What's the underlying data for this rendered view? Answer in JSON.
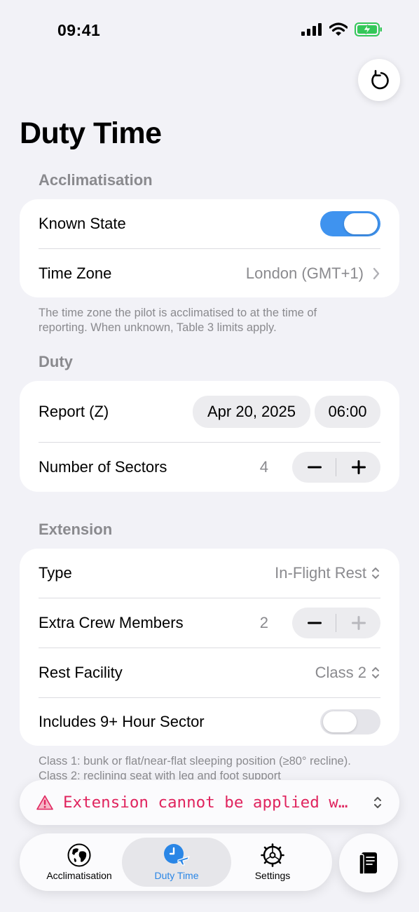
{
  "status": {
    "time": "09:41"
  },
  "page": {
    "title": "Duty Time"
  },
  "acclimatisation": {
    "header": "Acclimatisation",
    "known_state_label": "Known State",
    "known_state_on": true,
    "time_zone_label": "Time Zone",
    "time_zone_value": "London (GMT+1)",
    "footnote": "The time zone the pilot is acclimatised to at the time of reporting. When unknown, Table 3 limits apply."
  },
  "duty": {
    "header": "Duty",
    "report_label": "Report (Z)",
    "report_date": "Apr 20, 2025",
    "report_time": "06:00",
    "sectors_label": "Number of Sectors",
    "sectors_value": "4"
  },
  "extension": {
    "header": "Extension",
    "type_label": "Type",
    "type_value": "In-Flight Rest",
    "crew_label": "Extra Crew Members",
    "crew_value": "2",
    "facility_label": "Rest Facility",
    "facility_value": "Class 2",
    "nine_hour_label": "Includes 9+ Hour Sector",
    "nine_hour_on": false,
    "footnote": "Class 1: bunk or flat/near-flat sleeping position (≥80° recline). Class 2: reclining seat with leg and foot support"
  },
  "alert": {
    "text": "Extension cannot be applied w…"
  },
  "tabs": [
    {
      "label": "Acclimatisation",
      "icon": "globe-icon",
      "selected": false
    },
    {
      "label": "Duty Time",
      "icon": "clock-plane-icon",
      "selected": true
    },
    {
      "label": "Settings",
      "icon": "gear-icon",
      "selected": false
    }
  ],
  "colors": {
    "accent": "#3f93ef",
    "alert": "#e0245e",
    "tab_selected": "#2a86e6"
  }
}
